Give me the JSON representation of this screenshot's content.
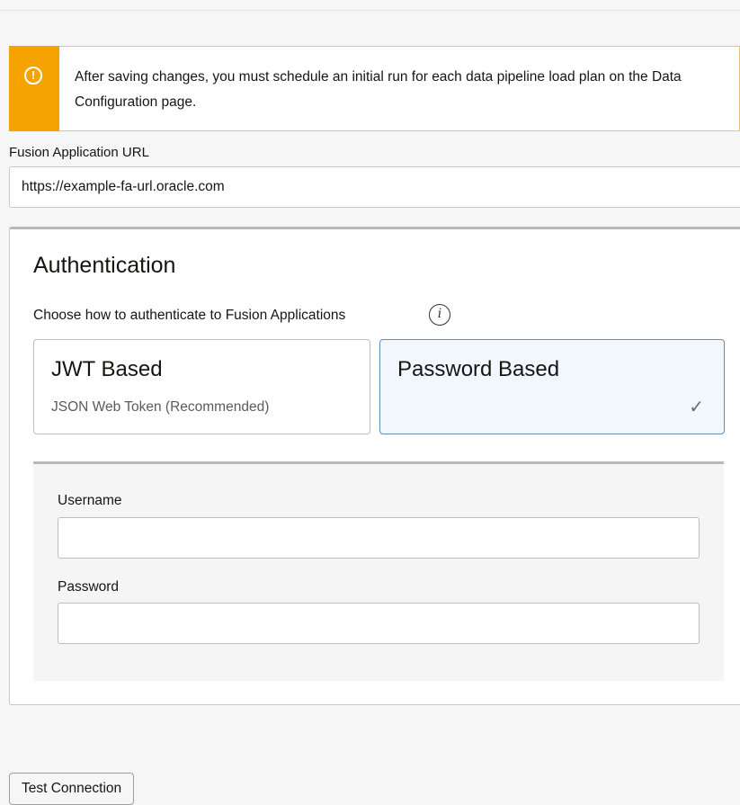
{
  "banner": {
    "message": "After saving changes, you must schedule an initial run for each data pipeline load plan on the Data Configuration page.",
    "icon": "warning-icon",
    "color": "#f5a300"
  },
  "url_field": {
    "label": "Fusion Application URL",
    "value": "https://example-fa-url.oracle.com"
  },
  "authentication": {
    "title": "Authentication",
    "subtitle": "Choose how to authenticate to Fusion Applications",
    "options": [
      {
        "title": "JWT Based",
        "description": "JSON Web Token (Recommended)",
        "selected": false
      },
      {
        "title": "Password Based",
        "description": "",
        "selected": true
      }
    ],
    "username_label": "Username",
    "username_value": "",
    "password_label": "Password",
    "password_value": ""
  },
  "actions": {
    "test_connection": "Test Connection"
  }
}
